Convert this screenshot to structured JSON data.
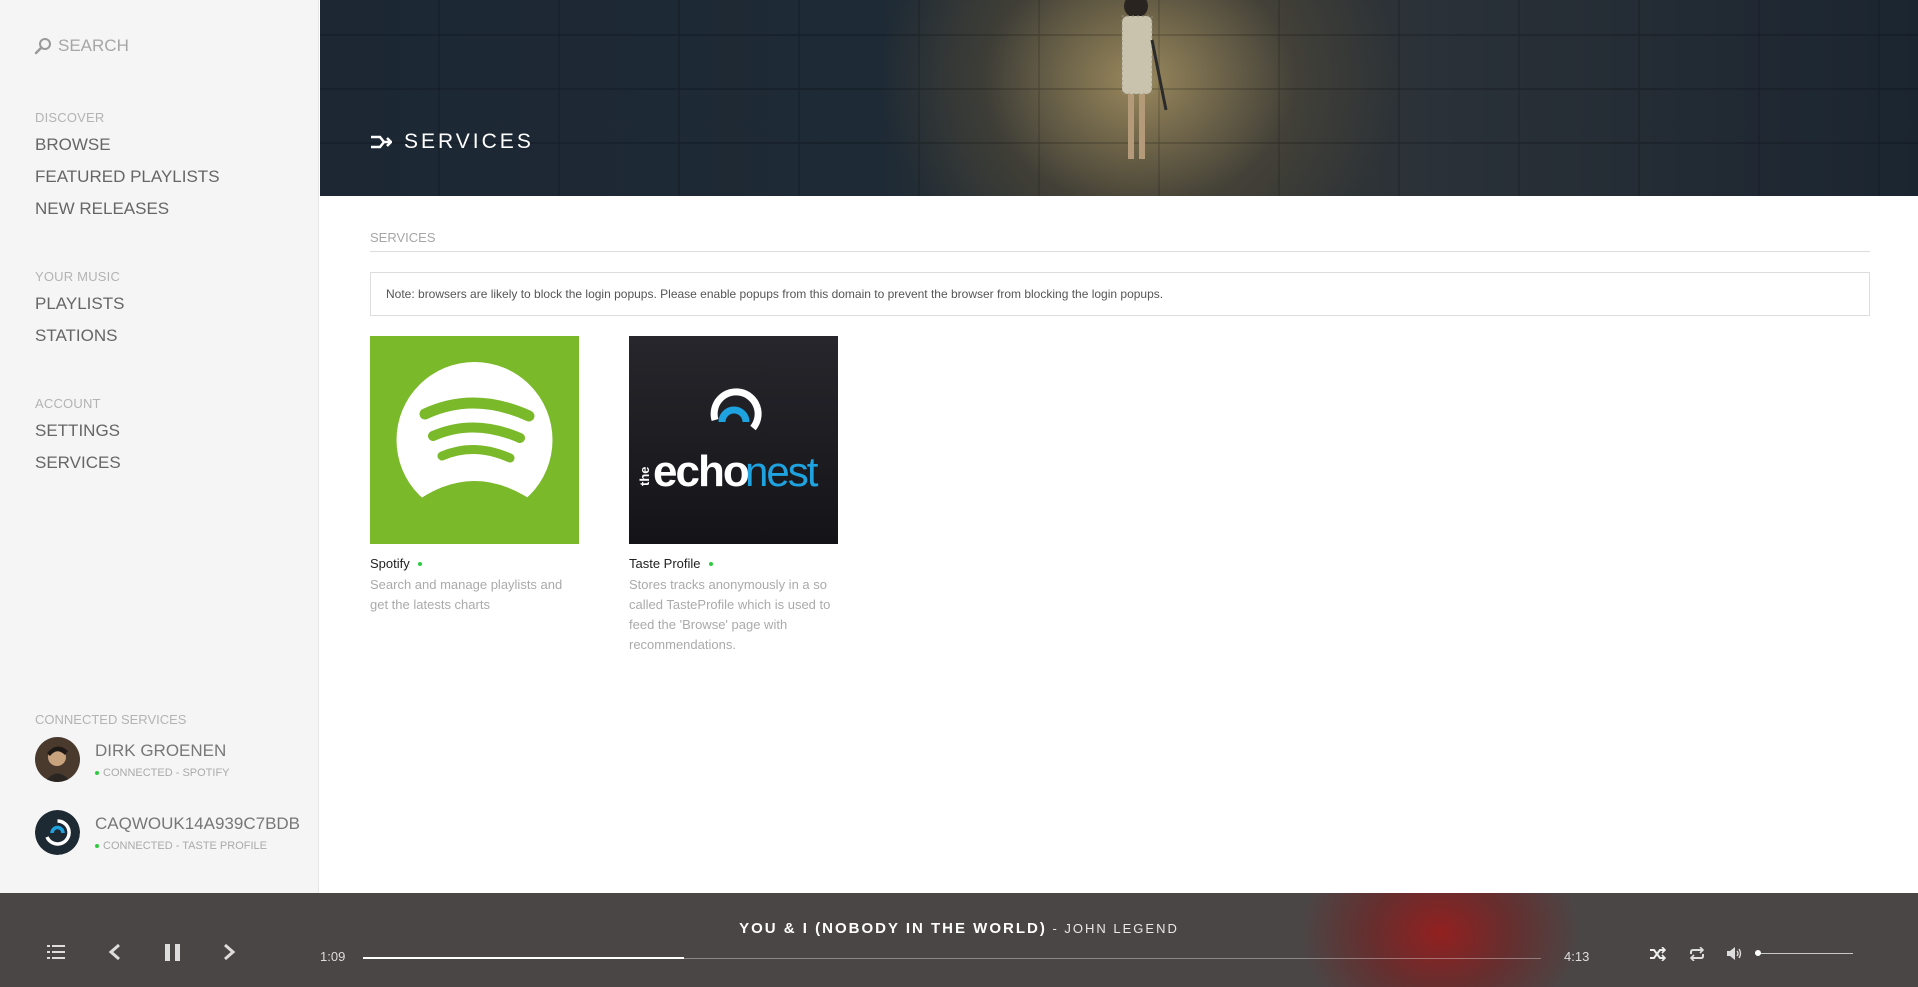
{
  "search": {
    "placeholder": "SEARCH"
  },
  "nav": {
    "discover": {
      "heading": "DISCOVER",
      "items": [
        "BROWSE",
        "FEATURED PLAYLISTS",
        "NEW RELEASES"
      ]
    },
    "your_music": {
      "heading": "YOUR MUSIC",
      "items": [
        "PLAYLISTS",
        "STATIONS"
      ]
    },
    "account": {
      "heading": "ACCOUNT",
      "items": [
        "SETTINGS",
        "SERVICES"
      ]
    }
  },
  "connected_services": {
    "heading": "CONNECTED SERVICES",
    "accounts": [
      {
        "name": "DIRK GROENEN",
        "status": "CONNECTED - SPOTIFY"
      },
      {
        "name": "CAQWOUK14A939C7BDB",
        "status": "CONNECTED - TASTE PROFILE"
      }
    ]
  },
  "header": {
    "title": "SERVICES",
    "icon": "plug-icon"
  },
  "main": {
    "section_title": "SERVICES",
    "note": "Note: browsers are likely to block the login popups. Please enable popups from this domain to prevent the browser from blocking the login popups.",
    "services": [
      {
        "name": "Spotify",
        "description": "Search and manage playlists and get the latests charts",
        "color": "#7ab929",
        "status_color": "#2ecc40"
      },
      {
        "name": "Taste Profile",
        "description": "Stores tracks anonymously in a so called TasteProfile which is used to feed the 'Browse' page with recommendations.",
        "color": "#1d1d22",
        "status_color": "#2ecc40",
        "logo_text_a": "the",
        "logo_text_b": "echo",
        "logo_text_c": "nest"
      }
    ]
  },
  "player": {
    "track": "YOU & I (NOBODY IN THE WORLD)",
    "separator": " - ",
    "artist": "JOHN LEGEND",
    "elapsed": "1:09",
    "duration": "4:13",
    "progress": 0.2727,
    "volume": 0.02
  },
  "colors": {
    "accent_green": "#7ab929",
    "status_green": "#2ecc40",
    "player_bg": "#4b4646",
    "header_bg": "#1c2733"
  }
}
